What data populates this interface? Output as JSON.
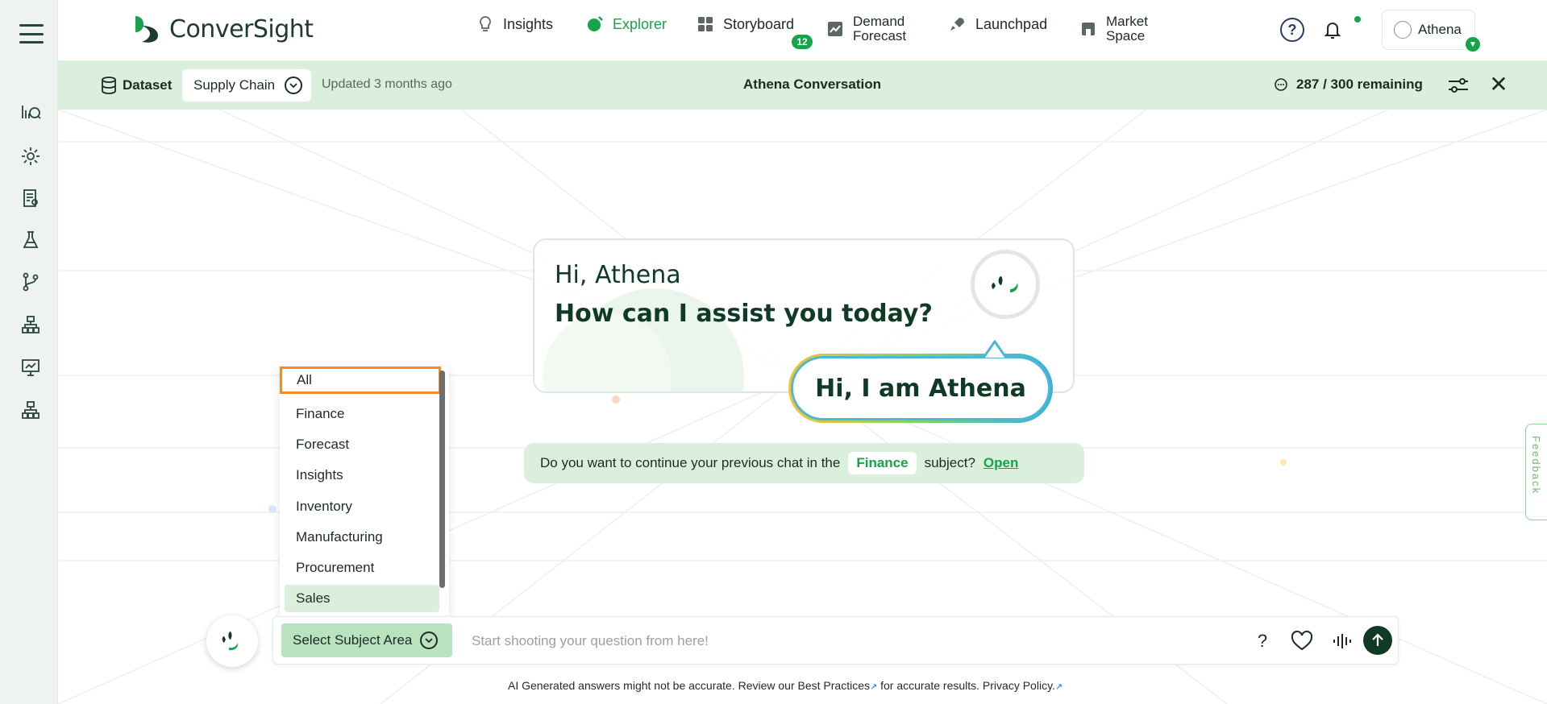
{
  "app": {
    "logo_text": "ConverSight",
    "brand_color": "#16a34a"
  },
  "sidebar": {
    "items": [
      {
        "icon": "insights-chat-icon"
      },
      {
        "icon": "gear-icon"
      },
      {
        "icon": "report-search-icon"
      },
      {
        "icon": "flask-icon"
      },
      {
        "icon": "git-branch-icon"
      },
      {
        "icon": "hierarchy-icon"
      },
      {
        "icon": "presentation-chart-icon"
      },
      {
        "icon": "org-chart-icon"
      }
    ]
  },
  "nav": {
    "insights": "Insights",
    "explorer": "Explorer",
    "storyboard": "Storyboard",
    "storyboard_badge": "12",
    "demand_forecast_line1": "Demand",
    "demand_forecast_line2": "Forecast",
    "launchpad": "Launchpad",
    "market_space_line1": "Market",
    "market_space_line2": "Space",
    "help": "?",
    "user_name": "Athena"
  },
  "dataset_bar": {
    "label": "Dataset",
    "selected_dataset": "Supply Chain",
    "updated": "Updated 3 months ago",
    "title": "Athena Conversation",
    "remaining": "287 / 300 remaining"
  },
  "welcome": {
    "greeting": "Hi, Athena",
    "question": "How can I assist you today?",
    "bubble": "Hi, I am Athena"
  },
  "continue_banner": {
    "text_before": "Do you want to continue your previous chat in the",
    "subject": "Finance",
    "text_after": "subject?",
    "link": "Open"
  },
  "subject_dropdown": {
    "options": [
      "All",
      "Finance",
      "Forecast",
      "Insights",
      "Inventory",
      "Manufacturing",
      "Procurement",
      "Sales"
    ],
    "highlighted": "All",
    "hovered": "Sales"
  },
  "composer": {
    "subject_button": "Select Subject Area",
    "placeholder": "Start shooting your question from here!",
    "help": "?"
  },
  "disclaimer": {
    "part1": "AI Generated answers might not be accurate. Review our Best Practices",
    "part2": " for accurate results. Privacy Policy.",
    "ext_glyph": "↗"
  },
  "feedback": "Feedback"
}
